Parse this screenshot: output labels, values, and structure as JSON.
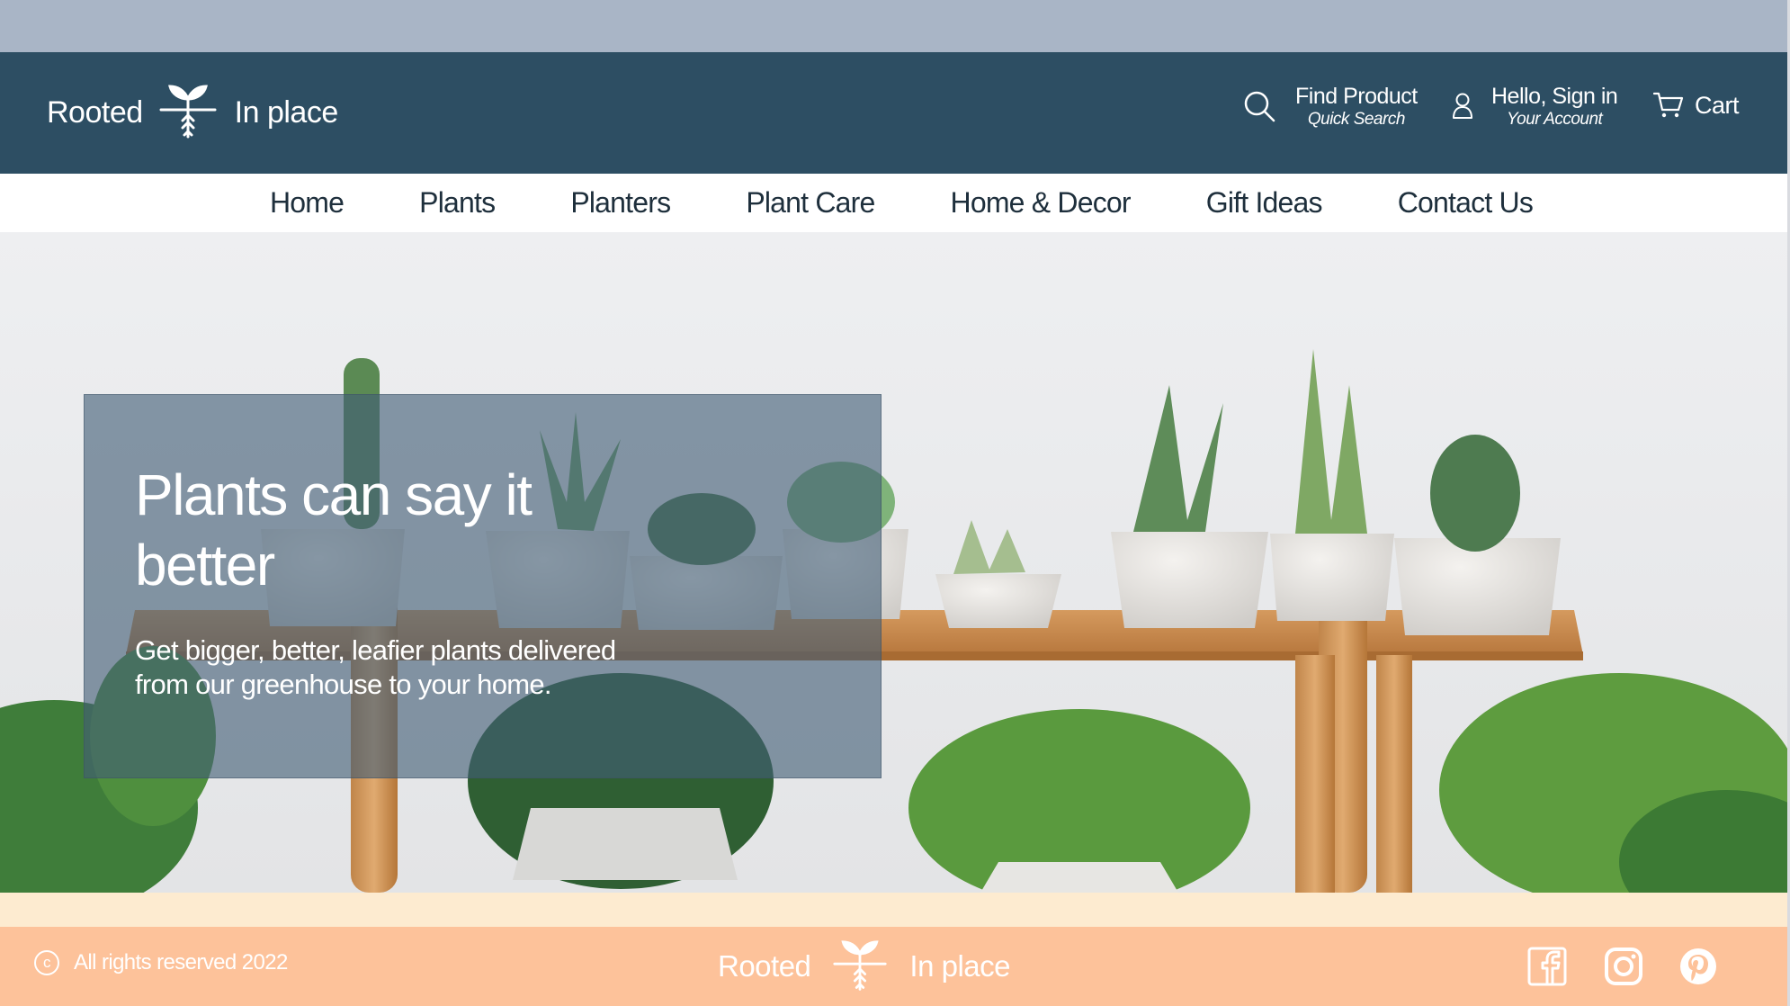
{
  "brand": {
    "name_left": "Rooted",
    "name_right": "In place",
    "logo_icon": "sprout-root-icon"
  },
  "header": {
    "search": {
      "label": "Find Product",
      "sublabel": "Quick Search",
      "icon": "search-icon"
    },
    "account": {
      "label": "Hello, Sign in",
      "sublabel": "Your Account",
      "icon": "user-icon"
    },
    "cart": {
      "label": "Cart",
      "icon": "cart-icon"
    }
  },
  "nav": {
    "items": [
      "Home",
      "Plants",
      "Planters",
      "Plant Care",
      "Home & Decor",
      "Gift Ideas",
      "Contact Us"
    ]
  },
  "hero": {
    "title": "Plants can say it better",
    "subtitle": "Get bigger, better, leafier plants delivered from our greenhouse to your home."
  },
  "footer": {
    "copyright": "All rights reserved 2022",
    "copyright_icon": "copyright-icon",
    "social": [
      "facebook-icon",
      "instagram-icon",
      "pinterest-icon"
    ]
  },
  "colors": {
    "top_bar": "#a9b5c6",
    "header": "#2d4e63",
    "hero_panel": "#425e76",
    "footer": "#fdc29a",
    "footer_strip": "#fdebd0"
  }
}
